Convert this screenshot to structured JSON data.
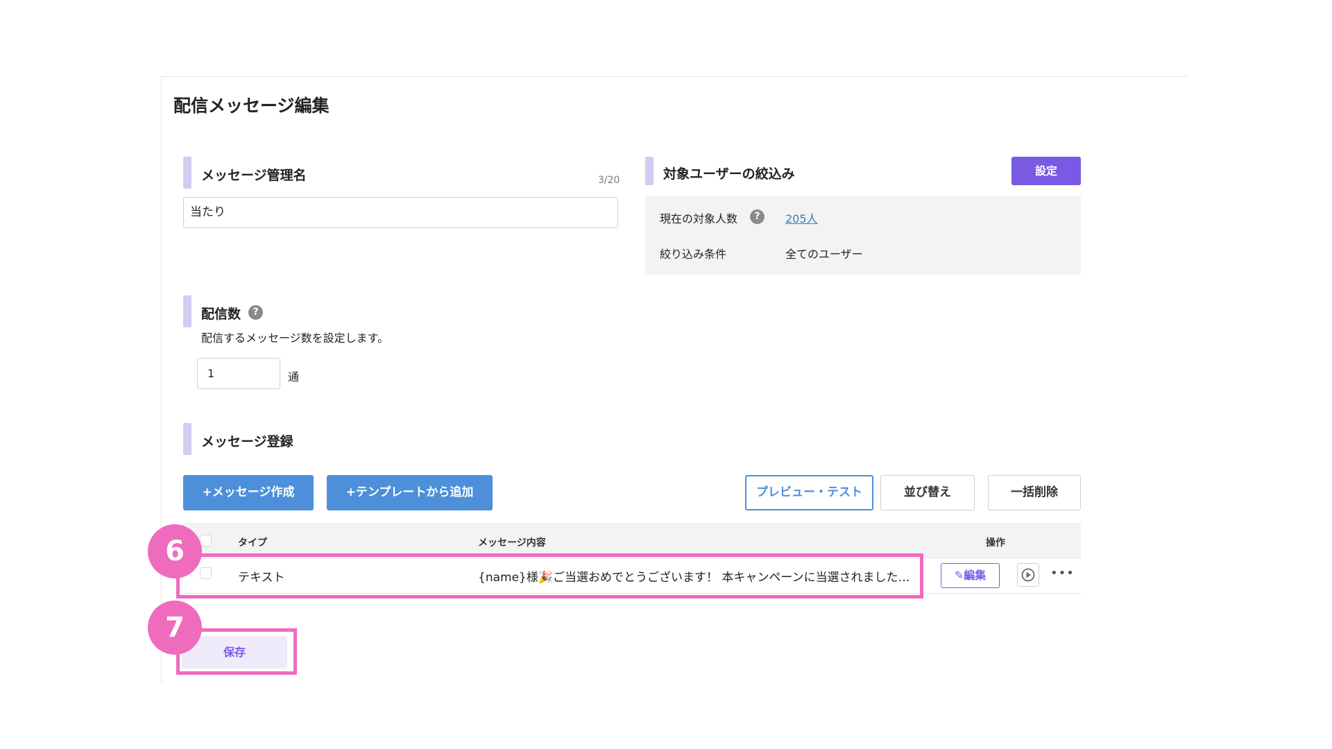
{
  "page": {
    "title": "配信メッセージ編集"
  },
  "message_name": {
    "section_title": "メッセージ管理名",
    "counter": "3/20",
    "value": "当たり"
  },
  "target": {
    "section_title": "対象ユーザーの絞込み",
    "set_button": "設定",
    "current_count_label": "現在の対象人数",
    "current_count_value": "205人",
    "filter_label": "絞り込み条件",
    "filter_value": "全てのユーザー"
  },
  "delivery": {
    "section_title": "配信数",
    "description": "配信するメッセージ数を設定します。",
    "value": "1",
    "unit": "通"
  },
  "registration": {
    "section_title": "メッセージ登録",
    "create_button": "+メッセージ作成",
    "template_button": "+テンプレートから追加",
    "preview_button": "プレビュー・テスト",
    "sort_button": "並び替え",
    "bulk_delete_button": "一括削除"
  },
  "table": {
    "headers": {
      "type": "タイプ",
      "content": "メッセージ内容",
      "actions": "操作"
    },
    "rows": [
      {
        "type": "テキスト",
        "content": "{name}様🎉ご当選おめでとうございます！ 本キャンペーンに当選されました…",
        "edit": "編集"
      }
    ]
  },
  "annotations": {
    "step_row": "6",
    "step_save": "7"
  },
  "save_button": "保存",
  "icons": {
    "help": "question-circle-icon",
    "edit": "pencil-icon",
    "play": "play-circle-icon",
    "more": "ellipsis-icon"
  },
  "colors": {
    "accent": "#7a59e3",
    "primary_blue": "#4d90d9",
    "highlight": "#ef6bbd",
    "section_bar": "#d4cbf2"
  }
}
